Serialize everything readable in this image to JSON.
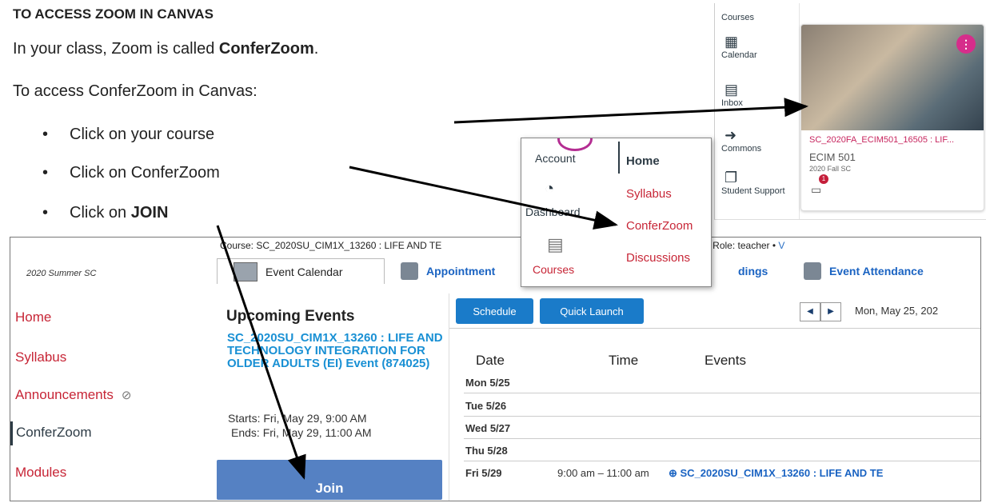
{
  "instructions": {
    "title": "TO ACCESS ZOOM IN CANVAS",
    "line1_pre": "In your class, Zoom is called ",
    "line1_bold": "ConferZoom",
    "line1_post": ".",
    "line2": "To access ConferZoom in Canvas:",
    "bullets": [
      "Click on your course",
      "Click on ConferZoom"
    ],
    "bullet3_pre": "Click on ",
    "bullet3_bold": "JOIN"
  },
  "canvas_nav": {
    "items": [
      {
        "label": "Courses",
        "icon": "courses-icon"
      },
      {
        "label": "Calendar",
        "icon": "calendar-icon"
      },
      {
        "label": "Inbox",
        "icon": "inbox-icon"
      },
      {
        "label": "Commons",
        "icon": "commons-icon"
      },
      {
        "label": "Student Support",
        "icon": "student-support-icon"
      }
    ]
  },
  "course_card": {
    "code": "SC_2020FA_ECIM501_16505 : LIF...",
    "name": "ECIM 501",
    "term": "2020 Fall SC",
    "badge": "1",
    "menu": "⋮"
  },
  "course_menu": {
    "left": [
      "Account",
      "Dashboard",
      "Courses"
    ],
    "right": [
      "Home",
      "Syllabus",
      "ConferZoom",
      "Discussions"
    ]
  },
  "zoom_page": {
    "breadcrumb_pre": "Course: SC_2020SU_CIM1X_13260 : LIFE AND TE",
    "breadcrumb_mid": "DER ADULTS (EI)  |  Role: teacher • ",
    "breadcrumb_link": "V",
    "term": "2020 Summer SC",
    "tabs": [
      "Event Calendar",
      "Appointment",
      "dings",
      "Event Attendance"
    ],
    "sidenav": [
      "Home",
      "Syllabus",
      "Announcements",
      "ConferZoom",
      "Modules"
    ],
    "upcoming_title": "Upcoming Events",
    "event_title": "SC_2020SU_CIM1X_13260 : LIFE AND TECHNOLOGY INTEGRATION FOR OLDER ADULTS (EI) Event (874025)",
    "starts": "Starts: Fri, May 29, 9:00 AM",
    "ends": "Ends: Fri, May 29, 11:00 AM",
    "join_label": "Join",
    "schedule_label": "Schedule",
    "quick_launch_label": "Quick Launch",
    "prev_label": "◀",
    "next_label": "▶",
    "date_title": "Mon, May 25, 202",
    "columns": [
      "Date",
      "Time",
      "Events"
    ],
    "rows": [
      "Mon 5/25",
      "Tue 5/26",
      "Wed 5/27",
      "Thu 5/28",
      "Fri 5/29"
    ],
    "event_time": "9:00 am – 11:00 am",
    "event_link": "SC_2020SU_CIM1X_13260 : LIFE AND TE"
  }
}
